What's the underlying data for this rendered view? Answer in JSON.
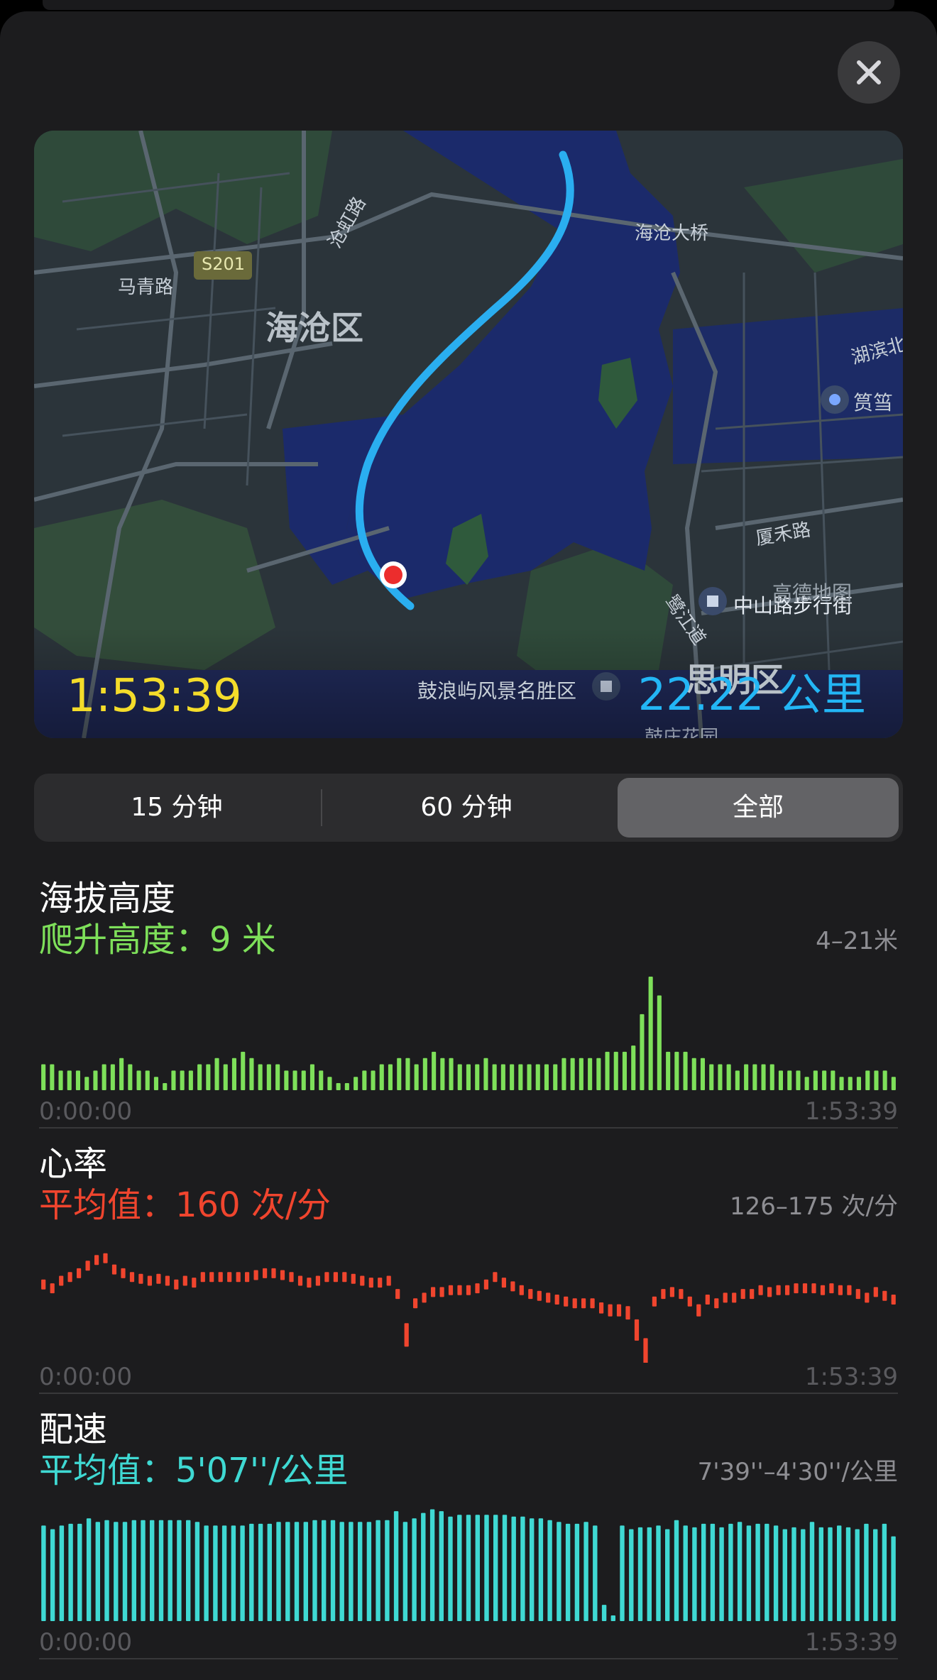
{
  "map": {
    "duration": "1:53:39",
    "distance": "22.22 公里",
    "labels": {
      "district_haicang": "海沧区",
      "district_siming": "思明区",
      "road_maqing": "马青路",
      "road_canghong": "沧虹路",
      "road_s201": "S201",
      "road_binhu_n": "湖滨北",
      "bridge_haicang": "海沧大桥",
      "road_xiahe": "厦禾路",
      "road_lujiang": "鹭江道",
      "poi_zhongshan": "中山路步行街",
      "poi_gulangyu": "鼓浪屿风景名胜区",
      "poi_yundang": "筼筜",
      "poi_huazhuang": "鼓庄花园",
      "watermark": "高德地图"
    }
  },
  "segments": {
    "items": [
      "15 分钟",
      "60 分钟",
      "全部"
    ],
    "selected_index": 2
  },
  "colors": {
    "elevation": "#7ee05a",
    "heart": "#f0452e",
    "pace": "#3fd9d3",
    "duration": "#f4dc2a",
    "distance": "#23b6f5"
  },
  "metrics": {
    "elevation": {
      "title": "海拔高度",
      "subtitle": "爬升高度：9 米",
      "range": "4–21米",
      "axis_start": "0:00:00",
      "axis_end": "1:53:39"
    },
    "heart": {
      "title": "心率",
      "subtitle": "平均值：160 次/分",
      "range": "126–175 次/分",
      "axis_start": "0:00:00",
      "axis_end": "1:53:39"
    },
    "pace": {
      "title": "配速",
      "subtitle": "平均值：5'07''/公里",
      "range": "7'39''–4'30''/公里",
      "axis_start": "0:00:00",
      "axis_end": "1:53:39"
    }
  },
  "chart_data": [
    {
      "type": "bar",
      "name": "elevation",
      "ylim": [
        4,
        21
      ],
      "values": [
        7,
        7,
        6,
        6,
        6,
        5,
        6,
        7,
        7,
        8,
        7,
        6,
        6,
        5,
        4,
        6,
        6,
        6,
        7,
        7,
        8,
        7,
        8,
        9,
        8,
        7,
        7,
        7,
        6,
        6,
        6,
        7,
        6,
        5,
        4,
        4,
        5,
        6,
        6,
        7,
        7,
        8,
        8,
        7,
        8,
        9,
        8,
        8,
        7,
        7,
        7,
        8,
        7,
        7,
        7,
        7,
        7,
        7,
        7,
        7,
        8,
        8,
        8,
        8,
        8,
        9,
        9,
        9,
        10,
        15,
        21,
        18,
        9,
        9,
        9,
        8,
        8,
        7,
        7,
        7,
        6,
        7,
        7,
        7,
        7,
        6,
        6,
        6,
        5,
        6,
        6,
        6,
        5,
        5,
        5,
        6,
        6,
        6,
        5
      ]
    },
    {
      "type": "bar",
      "name": "heart rate",
      "ylim": [
        126,
        175
      ],
      "values": [
        160,
        158,
        162,
        164,
        166,
        170,
        173,
        174,
        168,
        166,
        164,
        163,
        162,
        163,
        162,
        160,
        162,
        161,
        164,
        164,
        164,
        164,
        164,
        164,
        165,
        166,
        166,
        165,
        164,
        162,
        161,
        162,
        164,
        164,
        164,
        163,
        162,
        161,
        161,
        162,
        155,
        138,
        150,
        153,
        156,
        156,
        157,
        157,
        157,
        158,
        160,
        164,
        161,
        159,
        157,
        155,
        154,
        153,
        152,
        151,
        150,
        150,
        150,
        149,
        148,
        148,
        147,
        140,
        130,
        151,
        155,
        156,
        155,
        151,
        148,
        152,
        150,
        153,
        153,
        155,
        155,
        157,
        156,
        157,
        157,
        158,
        158,
        158,
        157,
        158,
        157,
        157,
        155,
        153,
        156,
        154,
        152
      ]
    },
    {
      "type": "bar",
      "name": "pace",
      "ylim": [
        7.65,
        4.5
      ],
      "values": [
        5.0,
        5.1,
        5.0,
        4.95,
        4.95,
        4.8,
        4.9,
        4.85,
        4.9,
        4.9,
        4.85,
        4.85,
        4.85,
        4.85,
        4.85,
        4.85,
        4.85,
        4.9,
        5.0,
        5.0,
        5.0,
        5.0,
        5.0,
        4.95,
        4.95,
        4.95,
        4.9,
        4.9,
        4.9,
        4.9,
        4.85,
        4.85,
        4.85,
        4.9,
        4.9,
        4.9,
        4.9,
        4.85,
        4.85,
        4.6,
        4.9,
        4.8,
        4.65,
        4.55,
        4.6,
        4.75,
        4.7,
        4.7,
        4.7,
        4.7,
        4.7,
        4.7,
        4.75,
        4.75,
        4.8,
        4.8,
        4.85,
        4.9,
        4.95,
        4.95,
        4.9,
        5.0,
        7.2,
        7.6,
        5.0,
        5.1,
        5.05,
        5.05,
        5.0,
        5.1,
        4.85,
        5.0,
        5.05,
        4.95,
        4.95,
        5.05,
        4.95,
        4.9,
        5.0,
        4.95,
        4.95,
        5.0,
        5.1,
        5.05,
        5.1,
        4.9,
        5.05,
        5.05,
        5.0,
        5.05,
        5.1,
        4.95,
        5.1,
        4.95,
        5.3
      ]
    }
  ]
}
